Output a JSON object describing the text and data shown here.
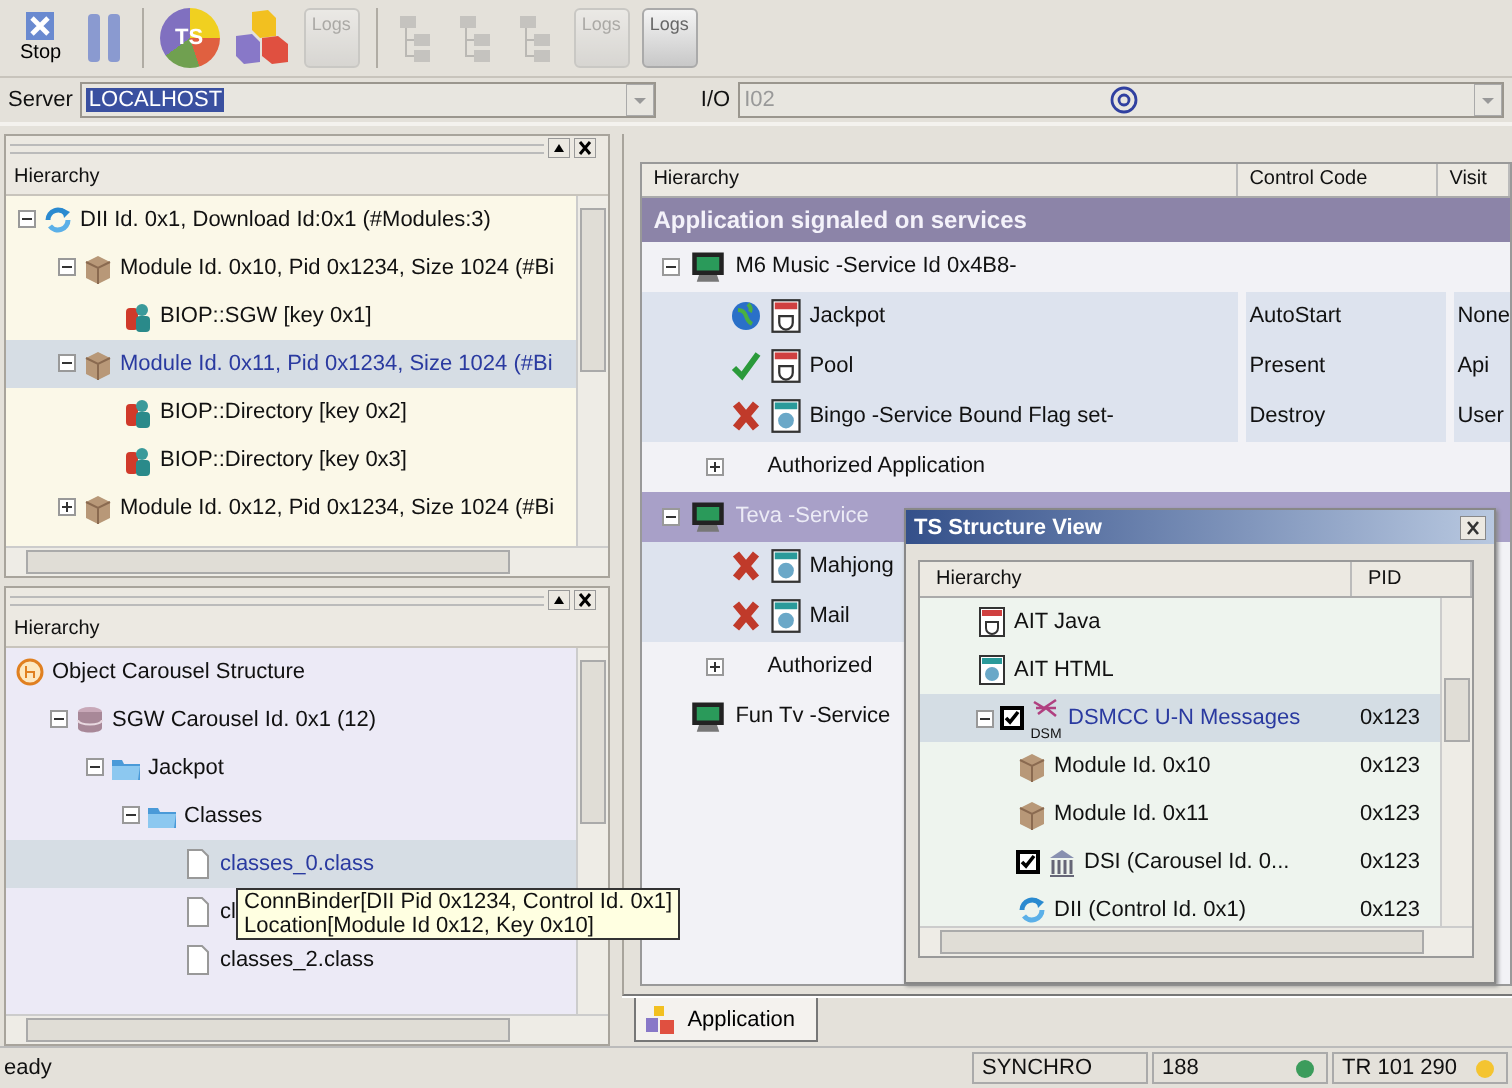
{
  "toolbar": {
    "buttons": [
      {
        "kind": "stop",
        "label": "Stop",
        "disabled": false
      },
      {
        "kind": "pause",
        "disabled": false
      },
      {
        "kind": "separator"
      },
      {
        "kind": "ts",
        "label": "TS",
        "disabled": false
      },
      {
        "kind": "cubes",
        "disabled": false
      },
      {
        "kind": "logs",
        "label": "Logs",
        "disabled": true
      },
      {
        "kind": "separator"
      },
      {
        "kind": "tree",
        "disabled": true
      },
      {
        "kind": "tree",
        "disabled": true
      },
      {
        "kind": "tree",
        "disabled": true
      },
      {
        "kind": "logs",
        "label": "Logs",
        "disabled": true
      },
      {
        "kind": "logs",
        "label": "Logs",
        "disabled": false
      }
    ]
  },
  "server_bar": {
    "server_label": "Server",
    "server_value": "LOCALHOST",
    "io_label": "I/O",
    "io_value": "I02"
  },
  "hierarchy_panel": {
    "header": "Hierarchy",
    "tree": [
      {
        "kind": "dii",
        "label": "DII Id. 0x1, Download Id:0x1 (#Modules:3)",
        "expanded": true,
        "selected": false,
        "children": [
          {
            "kind": "module",
            "label": "Module Id. 0x10, Pid 0x1234, Size 1024 (#Bi",
            "expanded": true,
            "selected": false,
            "children": [
              {
                "kind": "biop",
                "label": "BIOP::SGW [key 0x1]",
                "selected": false
              }
            ]
          },
          {
            "kind": "module",
            "label": "Module Id. 0x11, Pid 0x1234, Size 1024 (#Bi",
            "expanded": true,
            "selected": true,
            "children": [
              {
                "kind": "biop",
                "label": "BIOP::Directory [key 0x2]",
                "selected": false
              },
              {
                "kind": "biop",
                "label": "BIOP::Directory [key 0x3]",
                "selected": false
              }
            ]
          },
          {
            "kind": "module",
            "label": "Module Id. 0x12, Pid 0x1234, Size 1024 (#Bi",
            "expanded": false,
            "selected": false
          }
        ]
      }
    ]
  },
  "carousel_panel": {
    "header": "Hierarchy",
    "tree": [
      {
        "kind": "carousel",
        "label": "Object Carousel Structure",
        "expanded": true,
        "selected": false,
        "children": [
          {
            "kind": "database",
            "label": "SGW Carousel Id. 0x1 (12)",
            "expanded": true,
            "selected": false,
            "children": [
              {
                "kind": "folder",
                "label": "Jackpot",
                "expanded": true,
                "selected": false,
                "children": [
                  {
                    "kind": "folder",
                    "label": "Classes",
                    "expanded": true,
                    "selected": false,
                    "children": [
                      {
                        "kind": "file",
                        "label": "classes_0.class",
                        "selected": true
                      },
                      {
                        "kind": "file",
                        "label": "cl",
                        "selected": false
                      },
                      {
                        "kind": "file",
                        "label": "classes_2.class",
                        "selected": false
                      }
                    ]
                  }
                ]
              }
            ]
          }
        ]
      }
    ]
  },
  "services_table": {
    "columns": [
      "Hierarchy",
      "Control Code",
      "Visit"
    ],
    "group": "Application signaled on services",
    "services": [
      {
        "kind": "service",
        "name": "M6 Music -Service Id 0x4B8-",
        "expanded": true,
        "selected": false,
        "children": [
          {
            "kind": "app",
            "icons": [
              {
                "kind": "globe"
              },
              {
                "kind": "java"
              }
            ],
            "name": "Jackpot",
            "control_code": "AutoStart",
            "visibility": "None"
          },
          {
            "kind": "app",
            "icons": [
              {
                "kind": "check"
              },
              {
                "kind": "java"
              }
            ],
            "name": "Pool",
            "control_code": "Present",
            "visibility": "Api"
          },
          {
            "kind": "app",
            "icons": [
              {
                "kind": "cross"
              },
              {
                "kind": "html"
              }
            ],
            "name": "Bingo  -Service Bound Flag set-",
            "control_code": "Destroy",
            "visibility": "User"
          },
          {
            "kind": "folder",
            "name": "Authorized Application",
            "expanded": false
          }
        ]
      },
      {
        "kind": "service",
        "name": "Teva -Service",
        "expanded": true,
        "selected": true,
        "children": [
          {
            "kind": "app",
            "icons": [
              {
                "kind": "cross"
              },
              {
                "kind": "html"
              }
            ],
            "name": "Mahjong"
          },
          {
            "kind": "app",
            "icons": [
              {
                "kind": "cross"
              },
              {
                "kind": "html"
              }
            ],
            "name": "Mail"
          },
          {
            "kind": "folder",
            "name": "Authorized",
            "expanded": false
          }
        ]
      },
      {
        "kind": "service",
        "name": "Fun Tv -Service",
        "selected": false
      }
    ]
  },
  "tabs": [
    {
      "label": "Application",
      "selected": true
    }
  ],
  "structure_window": {
    "title": "TS Structure View",
    "columns": [
      "Hierarchy",
      "PID"
    ],
    "tree": [
      {
        "kind": "java",
        "label": "AIT Java",
        "selected": false
      },
      {
        "kind": "html",
        "label": "AIT HTML",
        "selected": false
      },
      {
        "kind": "dsm",
        "icon_label": "DSM",
        "label": "DSMCC U-N Messages",
        "pid": "0x123",
        "expanded": true,
        "checked": true,
        "selected": true,
        "children": [
          {
            "kind": "module",
            "label": "Module Id. 0x10",
            "pid": "0x123",
            "selected": false
          },
          {
            "kind": "module",
            "label": "Module Id. 0x11",
            "pid": "0x123",
            "selected": false
          },
          {
            "kind": "dsi",
            "label": "DSI (Carousel Id. 0...",
            "pid": "0x123",
            "checked": true,
            "selected": false
          },
          {
            "kind": "dii",
            "label": "DII (Control Id. 0x1)",
            "pid": "0x123",
            "selected": false
          }
        ]
      }
    ]
  },
  "tooltip": {
    "lines": [
      "ConnBinder[DII Pid 0x1234, Control Id. 0x1]",
      "Location[Module Id 0x12, Key 0x10]"
    ]
  },
  "status_bar": {
    "message": "eady",
    "fields": [
      {
        "text": "SYNCHRO"
      },
      {
        "text": "188",
        "color": "#3c9c5c"
      },
      {
        "text": "TR 101 290",
        "color": "#f4c430"
      }
    ]
  }
}
